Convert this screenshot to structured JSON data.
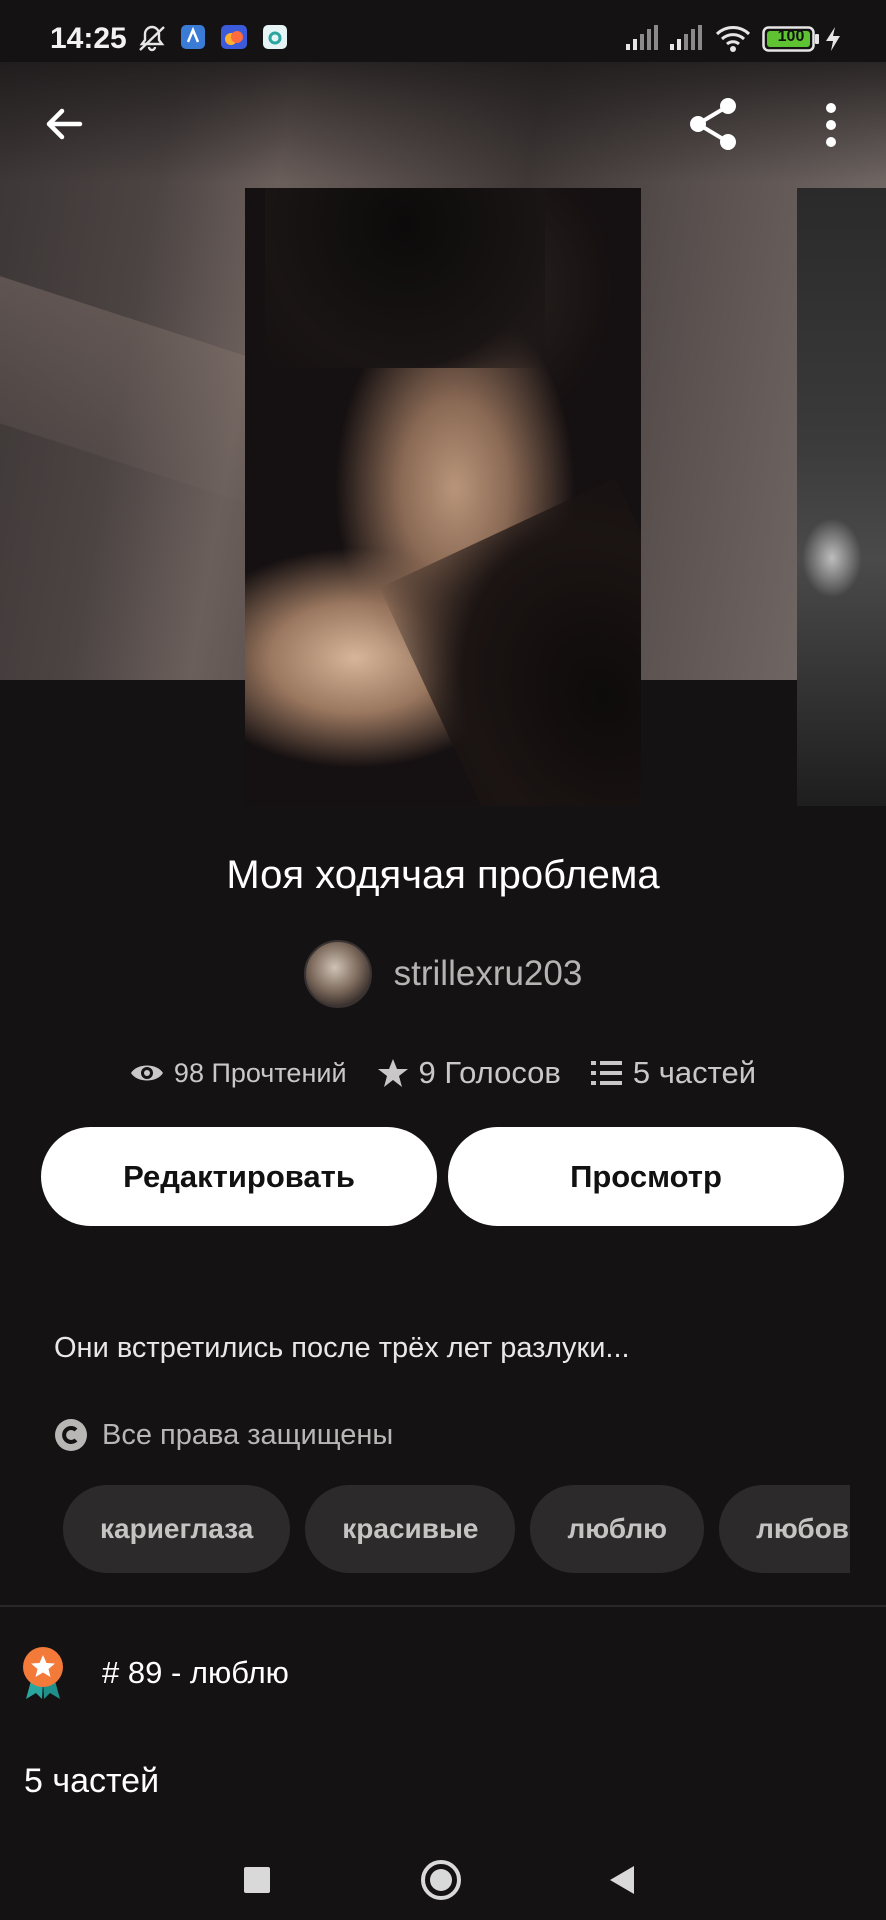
{
  "status_bar": {
    "time": "14:25",
    "battery": "100",
    "icons": [
      "mute-icon",
      "app-icon",
      "cloud-icon",
      "app-icon",
      "signal-icon",
      "signal-icon",
      "wifi-icon",
      "battery-icon",
      "charging-icon"
    ]
  },
  "toolbar": {
    "icons": [
      "back-arrow-icon",
      "share-icon",
      "more-vert-icon"
    ]
  },
  "story": {
    "title": "Моя ходячая проблема",
    "author": "strillexru203",
    "reads": "98 Прочтений",
    "votes": "9 Голосов",
    "parts": "5 частей",
    "description": "Они встретились после трёх лет разлуки...",
    "copyright": "Все права защищены"
  },
  "actions": {
    "edit_label": "Редактировать",
    "view_label": "Просмотр"
  },
  "tags": [
    "кариеглаза",
    "красивые",
    "люблю",
    "любовь"
  ],
  "ranking": {
    "text": "# 89 - люблю"
  },
  "parts_section": {
    "heading": "5 частей"
  },
  "colors": {
    "background": "#141213",
    "button_bg": "#ffffff",
    "tag_bg": "#2d2a2b",
    "badge_orange": "#f47a3a",
    "badge_teal": "#2aa6a0"
  }
}
